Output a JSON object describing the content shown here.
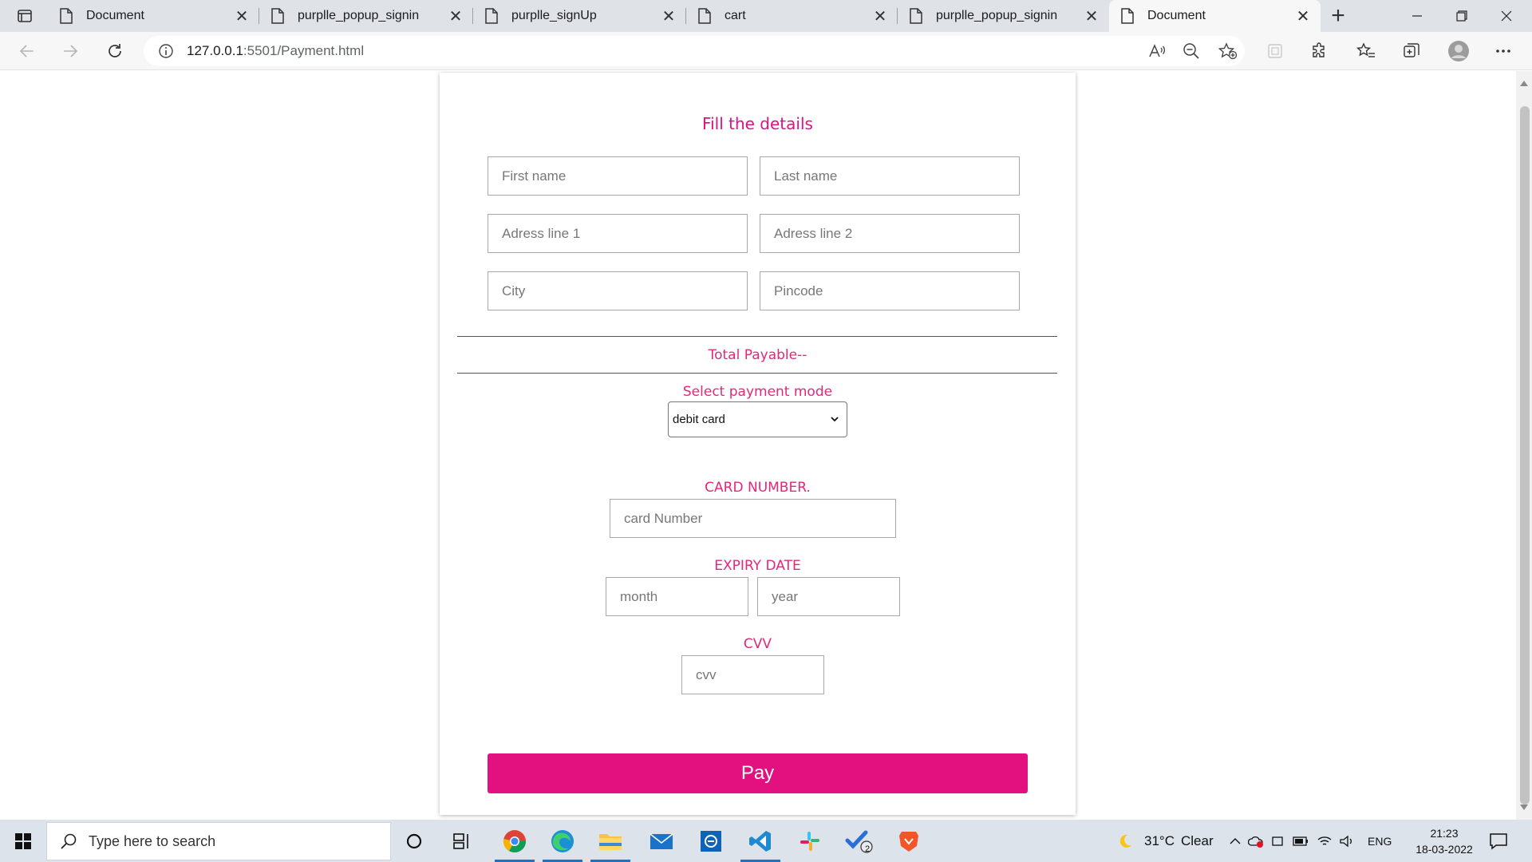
{
  "browser": {
    "tabs": [
      {
        "title": "Document",
        "active": false
      },
      {
        "title": "purplle_popup_signin",
        "active": false
      },
      {
        "title": "purplle_signUp",
        "active": false
      },
      {
        "title": "cart",
        "active": false
      },
      {
        "title": "purplle_popup_signin",
        "active": false
      },
      {
        "title": "Document",
        "active": true
      }
    ],
    "tab_close_glyph": "✕",
    "new_tab_glyph": "+",
    "address": {
      "host": "127.0.0.1",
      "rest": ":5501/Payment.html"
    }
  },
  "form": {
    "heading": "Fill the details",
    "placeholders": {
      "first_name": "First name",
      "last_name": "Last name",
      "address1": "Adress line 1",
      "address2": "Adress line 2",
      "city": "City",
      "pincode": "Pincode"
    },
    "total_payable": "Total Payable--",
    "payment_mode_label": "Select payment mode",
    "payment_mode_value": "debit card",
    "card_number_label": "CARD NUMBER.",
    "card_number_placeholder": "card Number",
    "expiry_label": "EXPIRY DATE",
    "month_placeholder": "month",
    "year_placeholder": "year",
    "cvv_label": "CVV",
    "cvv_placeholder": "cvv",
    "pay_label": "Pay"
  },
  "taskbar": {
    "search_placeholder": "Type here to search",
    "weather": "31°C",
    "weather_desc": "Clear",
    "language": "ENG",
    "time": "21:23",
    "date": "18-03-2022",
    "badge_count": "2"
  },
  "colors": {
    "accent": "#e3107f",
    "label_pink": "#e3287a",
    "taskbar": "#dde3ea",
    "tabstrip": "#dfe3e8"
  }
}
